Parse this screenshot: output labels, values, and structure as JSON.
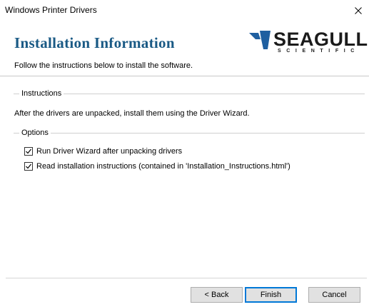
{
  "window": {
    "title": "Windows Printer Drivers"
  },
  "header": {
    "title": "Installation Information",
    "subtitle": "Follow the instructions below to install the software.",
    "logo": {
      "word": "SEAGULL",
      "sub": "SCIENTIFIC",
      "color": "#1b1b1b"
    },
    "title_color": "#1a5a85"
  },
  "instructions": {
    "label": "Instructions",
    "text": "After the drivers are unpacked, install them using the Driver Wizard."
  },
  "options": {
    "label": "Options",
    "items": [
      {
        "label": "Run Driver Wizard after unpacking drivers",
        "checked": true
      },
      {
        "label": "Read installation instructions (contained in 'Installation_Instructions.html')",
        "checked": true
      }
    ]
  },
  "buttons": {
    "back": "< Back",
    "finish": "Finish",
    "cancel": "Cancel"
  },
  "icons": {
    "close": "close-icon",
    "check": "checkmark-icon",
    "logo": "seagull-logo-mark"
  }
}
